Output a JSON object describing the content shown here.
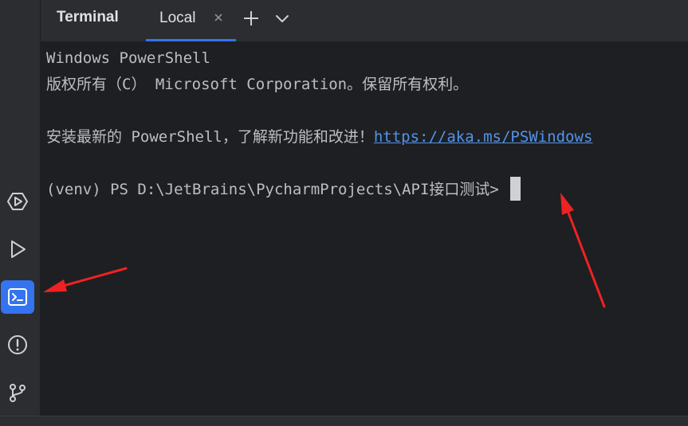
{
  "toolwindow": {
    "title": "Terminal",
    "tabs": [
      {
        "label": "Local"
      }
    ]
  },
  "sidebar": {
    "items": [
      {
        "name": "services",
        "icon": "services-icon"
      },
      {
        "name": "run",
        "icon": "run-icon"
      },
      {
        "name": "terminal",
        "icon": "terminal-icon",
        "active": true
      },
      {
        "name": "problems",
        "icon": "problems-icon"
      },
      {
        "name": "git",
        "icon": "git-branch-icon"
      }
    ]
  },
  "terminal": {
    "line1": "Windows PowerShell",
    "line2": "版权所有（C） Microsoft Corporation。保留所有权利。",
    "line3_prefix": "安装最新的 PowerShell，了解新功能和改进！",
    "line3_link": "https://aka.ms/PSWindows",
    "prompt": "(venv) PS D:\\JetBrains\\PycharmProjects\\API接口测试>"
  },
  "colors": {
    "accent": "#3574f0",
    "background": "#1e1f22",
    "panel": "#2b2d30",
    "link": "#5393e8",
    "annotation_arrow": "#ee2222"
  }
}
